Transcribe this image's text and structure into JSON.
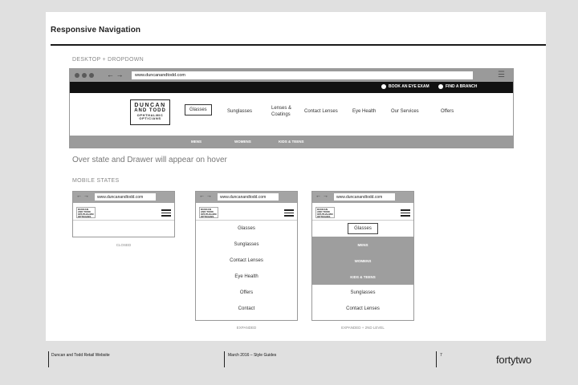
{
  "sheet": {
    "title": "Responsive Navigation",
    "desktop_label": "DESKTOP + DROPDOWN",
    "hover_note": "Over state and Drawer will appear on hover",
    "mobile_label": "MOBILE STATES"
  },
  "browser": {
    "url": "www.duncanandtodd.com",
    "nav_arrows": "← →",
    "menu_icon": "☰"
  },
  "site": {
    "top_actions": [
      "BOOK AN EYE EXAM",
      "FIND A BRANCH"
    ],
    "logo_lines": [
      "DUNCAN",
      "AND TODD",
      "OPHTHALMIC",
      "OPTICIANS"
    ],
    "nav": [
      "Glasses",
      "Sunglasses",
      "Lenses & Coatings",
      "Contact Lenses",
      "Eye Health",
      "Our Services",
      "Offers"
    ],
    "active_nav": "Glasses",
    "subnav": [
      "MENS",
      "WOMENS",
      "KIDS & TEENS"
    ]
  },
  "mobile": {
    "closed_caption": "CLOSED",
    "expanded_items": [
      "Glasses",
      "Sunglasses",
      "Contact Lenses",
      "Eye Health",
      "Offers",
      "Contact"
    ],
    "expanded_caption": "EXPANDED",
    "second_level_top": "Glasses",
    "second_level_sub": [
      "MENS",
      "WOMENS",
      "KIDS & TEENS"
    ],
    "second_level_rest": [
      "Sunglasses",
      "Contact Lenses"
    ],
    "second_level_caption": "EXPANDED + 2ND LEVEL"
  },
  "footer": {
    "project": "Duncan and Todd Retail Website",
    "date_doc": "March 2016  –  Style Guides",
    "page": "7",
    "brand": "fortytwo"
  }
}
